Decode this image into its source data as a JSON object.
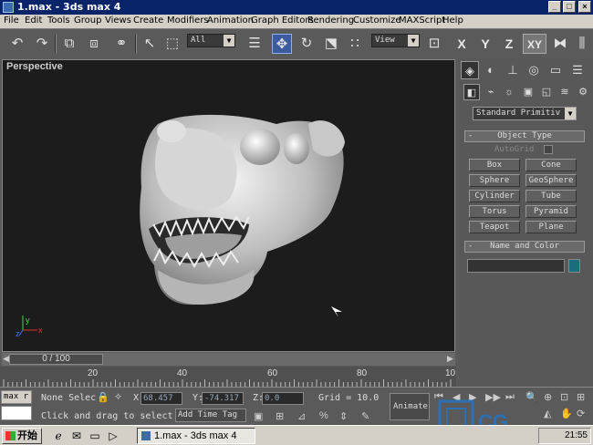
{
  "window": {
    "title": "1.max - 3ds max 4",
    "minimize": "_",
    "maximize": "□",
    "close": "×"
  },
  "menu": [
    "File",
    "Edit",
    "Tools",
    "Group",
    "Views",
    "Create",
    "Modifiers",
    "Animation",
    "Graph Editors",
    "Rendering",
    "Customize",
    "MAXScript",
    "Help"
  ],
  "toolbar": {
    "selection_filter": "All",
    "ref_coord": "View",
    "axes": [
      "X",
      "Y",
      "Z",
      "XY"
    ]
  },
  "viewport": {
    "label": "Perspective",
    "axis_labels": [
      "y",
      "x",
      "z"
    ]
  },
  "time_slider": {
    "frame_readout": "0 / 100"
  },
  "trackbar": {
    "ticks": [
      "20",
      "40",
      "60",
      "80",
      "10"
    ]
  },
  "command_panel": {
    "tabs": [
      "create-icon",
      "modify-icon",
      "hierarchy-icon",
      "motion-icon",
      "display-icon",
      "utilities-icon"
    ],
    "subtabs": [
      "geometry-icon",
      "shapes-icon",
      "lights-icon",
      "cameras-icon",
      "helpers-icon",
      "spacewarps-icon",
      "systems-icon"
    ],
    "category": "Standard Primitiv",
    "object_type_title": "Object Type",
    "autogrid_label": "AutoGrid",
    "buttons": [
      "Box",
      "Cone",
      "Sphere",
      "GeoSphere",
      "Cylinder",
      "Tube",
      "Torus",
      "Pyramid",
      "Teapot",
      "Plane"
    ],
    "name_color_title": "Name and Color",
    "rollout_minus": "-",
    "swatch_color": "#1a6d7c"
  },
  "status": {
    "listener": "max r",
    "selection": "None Selec",
    "x_label": "X:",
    "x_value": "68.457",
    "y_label": "Y:",
    "y_value": "-74.317",
    "z_label": "Z:",
    "z_value": "0.0",
    "grid": "Grid = 10.0",
    "prompt": "Click and drag to select",
    "add_time_tag": "Add Time Tag",
    "animate": "Animate"
  },
  "taskbar": {
    "start": "开始",
    "task": "1.max - 3ds max 4",
    "clock": "21:55"
  },
  "watermark": {
    "text": "CG"
  }
}
